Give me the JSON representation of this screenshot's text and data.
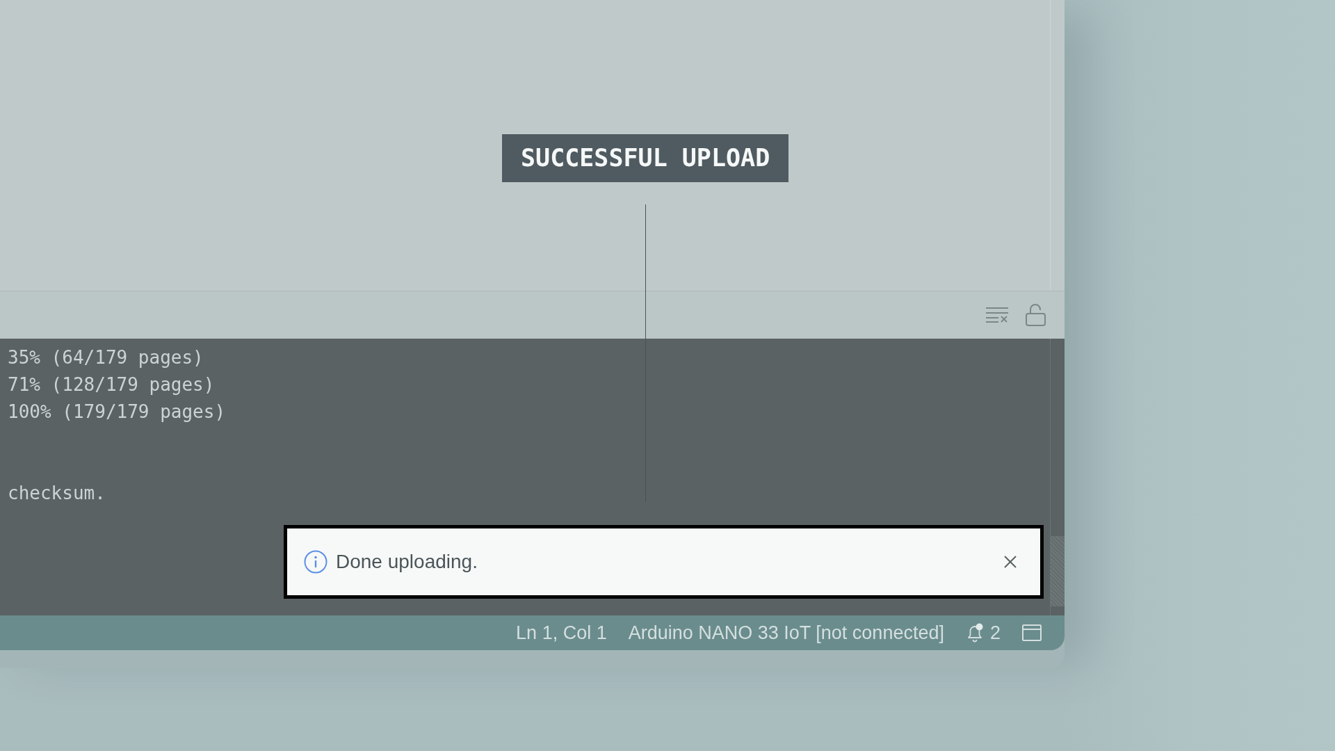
{
  "annotation": {
    "label": "SUCCESSFUL UPLOAD"
  },
  "output": {
    "lines": [
      {
        "kind": "text",
        "text": "35% (64/179 pages)"
      },
      {
        "kind": "text",
        "text": "71% (128/179 pages)"
      },
      {
        "kind": "text",
        "text": "100% (179/179 pages)"
      },
      {
        "kind": "blank"
      },
      {
        "kind": "blank"
      },
      {
        "kind": "text",
        "text": "checksum."
      }
    ]
  },
  "notification": {
    "message": "Done uploading."
  },
  "status_bar": {
    "position": "Ln 1, Col 1",
    "board": "Arduino NANO 33 IoT [not connected]",
    "notifications": {
      "count": "2",
      "unread": true
    }
  }
}
